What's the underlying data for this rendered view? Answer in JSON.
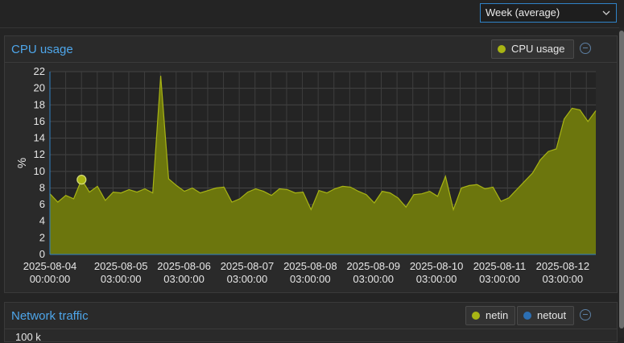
{
  "toolbar": {
    "timeframe": "Week (average)"
  },
  "cpu_panel": {
    "title": "CPU usage",
    "legend": "CPU usage",
    "legend_color": "#a8b414"
  },
  "net_panel": {
    "title": "Network traffic",
    "legend": [
      {
        "label": "netin",
        "color": "#a8b414"
      },
      {
        "label": "netout",
        "color": "#2c6fb3"
      }
    ],
    "first_tick": "100 k"
  },
  "chart_data": {
    "type": "area",
    "title": "CPU usage",
    "xlabel": "",
    "ylabel": "%",
    "ylim": [
      0,
      22
    ],
    "yticks": [
      0,
      2,
      4,
      6,
      8,
      10,
      12,
      14,
      16,
      18,
      20,
      22
    ],
    "x_ticks": [
      {
        "day": 0.0,
        "line1": "2025-08-04",
        "line2": "00:00:00"
      },
      {
        "day": 1.125,
        "line1": "2025-08-05",
        "line2": "03:00:00"
      },
      {
        "day": 2.125,
        "line1": "2025-08-06",
        "line2": "03:00:00"
      },
      {
        "day": 3.125,
        "line1": "2025-08-07",
        "line2": "03:00:00"
      },
      {
        "day": 4.125,
        "line1": "2025-08-08",
        "line2": "03:00:00"
      },
      {
        "day": 5.125,
        "line1": "2025-08-09",
        "line2": "03:00:00"
      },
      {
        "day": 6.125,
        "line1": "2025-08-10",
        "line2": "03:00:00"
      },
      {
        "day": 7.125,
        "line1": "2025-08-11",
        "line2": "03:00:00"
      },
      {
        "day": 8.125,
        "line1": "2025-08-12",
        "line2": "03:00:00"
      }
    ],
    "x_range_days": [
      0,
      8.65
    ],
    "grid": true,
    "series": [
      {
        "name": "CPU usage",
        "color": "#a8b414",
        "fill": "#6c760d",
        "values": [
          7.3,
          6.3,
          7.1,
          6.7,
          9.0,
          7.5,
          8.2,
          6.5,
          7.5,
          7.4,
          7.8,
          7.5,
          7.9,
          7.4,
          21.5,
          9.1,
          8.3,
          7.6,
          8.0,
          7.4,
          7.7,
          8.0,
          8.1,
          6.3,
          6.7,
          7.5,
          7.9,
          7.6,
          7.1,
          7.9,
          7.8,
          7.4,
          7.5,
          5.4,
          7.7,
          7.4,
          7.9,
          8.2,
          8.1,
          7.6,
          7.2,
          6.2,
          7.6,
          7.4,
          6.8,
          5.7,
          7.2,
          7.3,
          7.6,
          7.0,
          9.4,
          5.4,
          8.0,
          8.3,
          8.4,
          7.9,
          8.1,
          6.4,
          6.8,
          7.8,
          8.8,
          9.8,
          11.4,
          12.4,
          12.7,
          16.3,
          17.6,
          17.4,
          16.0,
          17.3
        ]
      }
    ],
    "highlight": {
      "index": 4,
      "value": 9.0
    }
  }
}
